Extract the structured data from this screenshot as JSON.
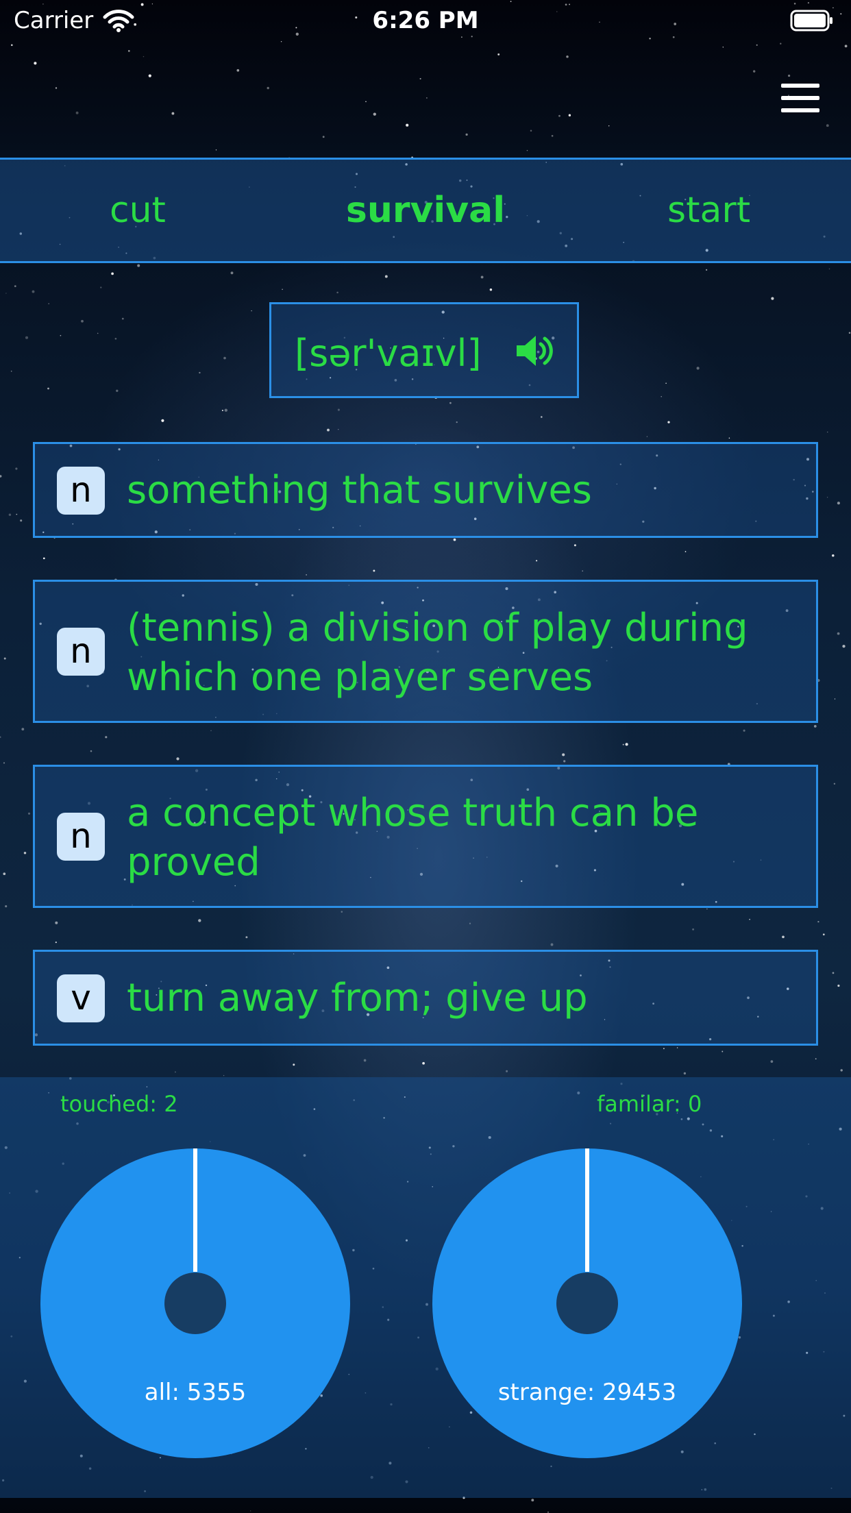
{
  "status_bar": {
    "carrier": "Carrier",
    "time": "6:26 PM"
  },
  "nav": {
    "prev_word": "cut",
    "current_word": "survival",
    "next_word": "start"
  },
  "pronunciation": {
    "phonetic": "[sər'vaɪvl]",
    "icon": "speaker-icon"
  },
  "senses": [
    {
      "pos": "n",
      "definition": "something that survives"
    },
    {
      "pos": "n",
      "definition": "(tennis) a division of play during which one player serves"
    },
    {
      "pos": "n",
      "definition": "a concept whose truth can be proved"
    },
    {
      "pos": "v",
      "definition": "turn away from; give up"
    }
  ],
  "stats": {
    "touched_label": "touched: 2",
    "all_label": "all: 5355",
    "familiar_label": "familar: 0",
    "strange_label": "strange: 29453",
    "touched": 2,
    "all": 5355,
    "familiar": 0,
    "strange": 29453
  },
  "colors": {
    "accent": "#2b8fe6",
    "word_green": "#2bdc45",
    "pie_fill": "#2192ef"
  }
}
